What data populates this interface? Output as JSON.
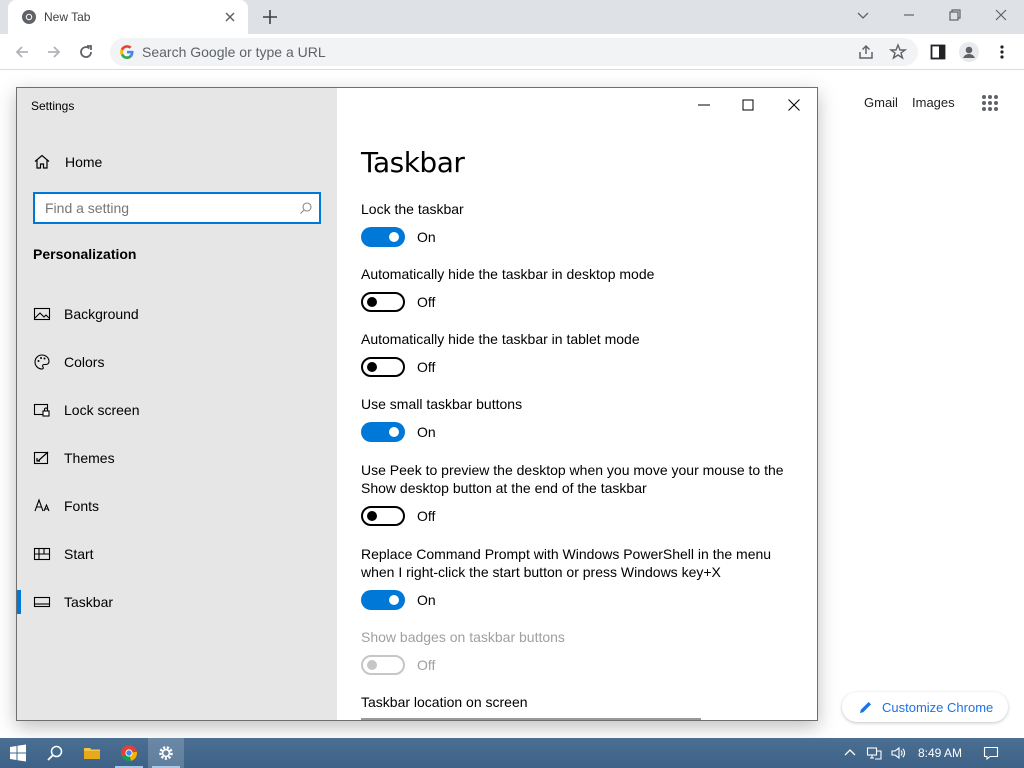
{
  "browser": {
    "tab_title": "New Tab",
    "omnibox_placeholder": "Search Google or type a URL",
    "ntp_links": [
      "Gmail",
      "Images"
    ],
    "customize_label": "Customize Chrome"
  },
  "settings": {
    "window_title": "Settings",
    "home_label": "Home",
    "search_placeholder": "Find a setting",
    "section_label": "Personalization",
    "nav": [
      {
        "label": "Background",
        "icon": "picture-icon"
      },
      {
        "label": "Colors",
        "icon": "palette-icon"
      },
      {
        "label": "Lock screen",
        "icon": "lock-screen-icon"
      },
      {
        "label": "Themes",
        "icon": "themes-icon"
      },
      {
        "label": "Fonts",
        "icon": "fonts-icon"
      },
      {
        "label": "Start",
        "icon": "start-icon"
      },
      {
        "label": "Taskbar",
        "icon": "taskbar-icon",
        "active": true
      }
    ],
    "page_title": "Taskbar",
    "options": [
      {
        "label": "Lock the taskbar",
        "state": "On"
      },
      {
        "label": "Automatically hide the taskbar in desktop mode",
        "state": "Off"
      },
      {
        "label": "Automatically hide the taskbar in tablet mode",
        "state": "Off"
      },
      {
        "label": "Use small taskbar buttons",
        "state": "On"
      },
      {
        "label": "Use Peek to preview the desktop when you move your mouse to the Show desktop button at the end of the taskbar",
        "state": "Off"
      },
      {
        "label": "Replace Command Prompt with Windows PowerShell in the menu when I right-click the start button or press Windows key+X",
        "state": "On"
      },
      {
        "label": "Show badges on taskbar buttons",
        "state": "Off",
        "disabled": true
      }
    ],
    "location_label": "Taskbar location on screen"
  },
  "taskbar": {
    "clock": "8:49 AM"
  },
  "colors": {
    "accent": "#0078d7",
    "chrome_link": "#1a73e8",
    "taskbar": "#3e6287"
  }
}
